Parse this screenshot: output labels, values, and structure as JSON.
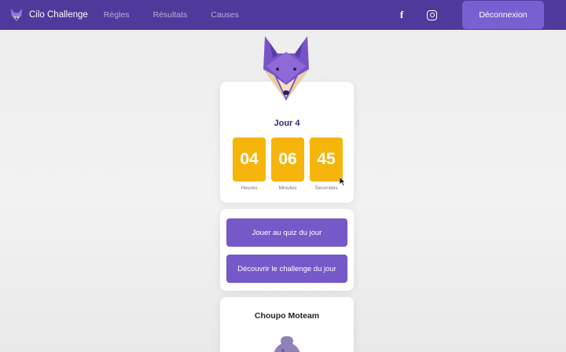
{
  "navbar": {
    "brand": "Cilo Challenge",
    "links": [
      "Règles",
      "Résultats",
      "Causes"
    ],
    "facebook_icon": "f",
    "logout_label": "Déconnexion",
    "colors": {
      "background": "#4d3a9a",
      "button": "#7a5fd0"
    }
  },
  "countdown": {
    "title": "Jour 4",
    "hours": "04",
    "minutes": "06",
    "seconds": "45",
    "hours_label": "Heures",
    "minutes_label": "Minutes",
    "seconds_label": "Secondes",
    "digit_color": "#f5b50a"
  },
  "actions": {
    "quiz_button": "Jouer au quiz du jour",
    "challenge_button": "Découvrir le challenge du jour",
    "button_color": "#7559c8"
  },
  "team": {
    "name": "Choupo Moteam"
  },
  "icons": [
    "fox-logo-icon",
    "facebook-icon",
    "instagram-icon",
    "fox-mascot-icon",
    "cursor-icon",
    "team-avatar-icon"
  ]
}
